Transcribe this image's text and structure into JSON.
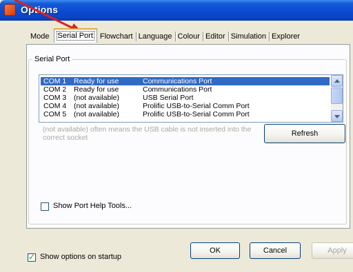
{
  "window": {
    "title": "Options"
  },
  "tabs": [
    {
      "label": "Mode"
    },
    {
      "label": "Serial Port",
      "active": true
    },
    {
      "label": "Flowchart"
    },
    {
      "label": "Language"
    },
    {
      "label": "Colour"
    },
    {
      "label": "Editor"
    },
    {
      "label": "Simulation"
    },
    {
      "label": "Explorer"
    }
  ],
  "serial_port": {
    "group_label": "Serial Port",
    "ports": [
      {
        "port": "COM 1",
        "status": "Ready for use",
        "description": "Communications Port",
        "selected": true
      },
      {
        "port": "COM 2",
        "status": "Ready for use",
        "description": "Communications Port"
      },
      {
        "port": "COM 3",
        "status": "(not available)",
        "description": "USB Serial Port"
      },
      {
        "port": "COM 4",
        "status": "(not available)",
        "description": "Prolific USB-to-Serial Comm Port"
      },
      {
        "port": "COM 5",
        "status": "(not available)",
        "description": "Prolific USB-to-Serial Comm Port"
      }
    ],
    "hint": "(not available) often means the USB cable is not inserted into the correct socket",
    "refresh_label": "Refresh",
    "show_help_tools": {
      "label": "Show Port Help Tools...",
      "checked": false
    }
  },
  "footer": {
    "show_on_startup": {
      "label": "Show options on startup",
      "checked": true
    },
    "ok_label": "OK",
    "cancel_label": "Cancel",
    "apply_label": "Apply"
  },
  "colors": {
    "titlebar": "#0a4bd3",
    "selection": "#316ac5",
    "annotation_arrow": "#e0201b",
    "dialog_face": "#ece9d8"
  },
  "icons": [
    "app-icon",
    "annotation-arrow-icon",
    "scroll-up-icon",
    "scroll-down-icon",
    "checkmark-icon"
  ]
}
